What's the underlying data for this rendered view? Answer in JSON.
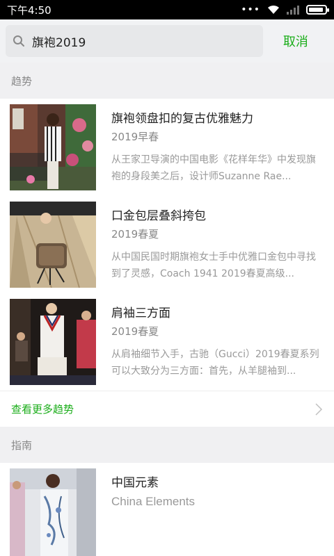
{
  "status_bar": {
    "time": "下午4:50",
    "dots": "•••",
    "battery_level": 0.9
  },
  "search": {
    "value": "旗袍2019",
    "cancel_label": "取消"
  },
  "trends": {
    "header": "趋势",
    "items": [
      {
        "title": "旗袍领盘扣的复古优雅魅力",
        "subtitle": "2019早春",
        "desc": "从王家卫导演的中国电影《花样年华》中发现旗袍的身段美之后，设计师Suzanne Rae..."
      },
      {
        "title": "口金包层叠斜挎包",
        "subtitle": "2019春夏",
        "desc": "从中国民国时期旗袍女士手中优雅口金包中寻找到了灵感，Coach 1941 2019春夏高级..."
      },
      {
        "title": "肩袖三方面",
        "subtitle": "2019春夏",
        "desc": "从肩袖细节入手，古驰（Gucci）2019春夏系列可以大致分为三方面：首先，从羊腿袖到..."
      }
    ],
    "more_label": "查看更多趋势"
  },
  "guides": {
    "header": "指南",
    "items": [
      {
        "title": "中国元素",
        "subtitle": "China Elements"
      }
    ]
  }
}
